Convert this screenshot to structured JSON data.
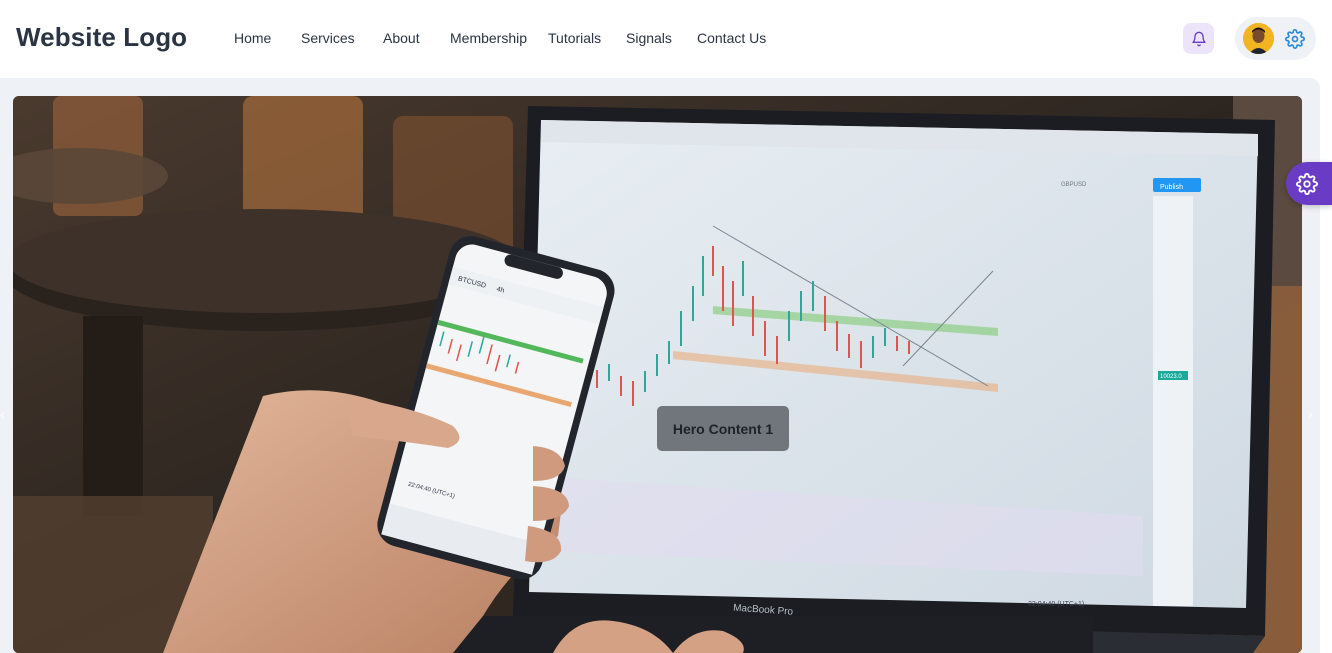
{
  "header": {
    "logo": "Website Logo",
    "nav": [
      "Home",
      "Services",
      "About",
      "Membership",
      "Tutorials",
      "Signals",
      "Contact Us"
    ]
  },
  "hero": {
    "caption": "Hero Content 1",
    "laptop_brand": "MacBook Pro",
    "chart_publish": "Publish",
    "chart_symbol": "GBPUSD",
    "phone_symbol": "BTCUSD",
    "phone_interval": "4h",
    "chart_time": "22:04:40 (UTC+1)",
    "phone_time": "22:04:40 (UTC+1)",
    "price_tag": "10023.0"
  },
  "colors": {
    "accent": "#6a3cc6",
    "brand_text": "#2b3442",
    "bell_bg": "#ece4fb",
    "settings_icon": "#2e8ad8"
  }
}
